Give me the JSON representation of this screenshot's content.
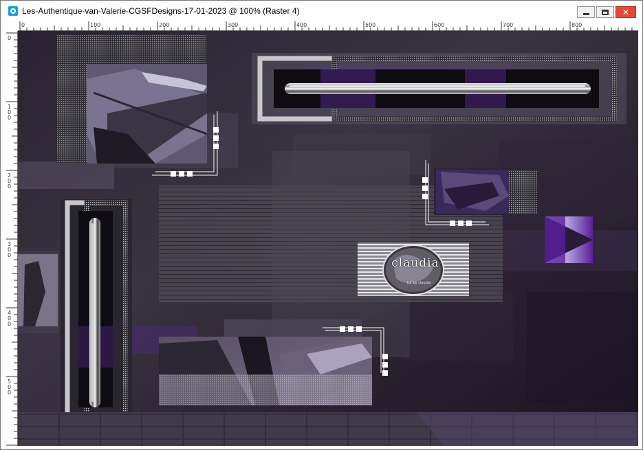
{
  "window": {
    "title": "Les-Authentique-van-Valerie-CGSFDesigns-17-01-2023 @ 100% (Raster 4)",
    "icon": "paintshop-icon",
    "buttons": {
      "minimize": "minimize-icon",
      "maximize": "maximize-icon",
      "close": "close-icon"
    }
  },
  "ruler": {
    "horizontal_labels": [
      "0",
      "100",
      "200",
      "300",
      "400",
      "500",
      "600",
      "700",
      "800"
    ],
    "vertical_labels": [
      "0",
      "100",
      "200",
      "300",
      "400",
      "500"
    ],
    "units": "pixels",
    "zoom": "100%"
  },
  "artwork": {
    "watermark": {
      "text": "claudia",
      "subtext": "tut by claudia",
      "logo_lettering": true
    },
    "palette": {
      "background": "#1e1826",
      "deep_purple": "#3a2556",
      "violet_glow": "#6a2ea8",
      "lavender": "#9c8fb8",
      "silver": "#c8c8cc",
      "white": "#ffffff"
    }
  }
}
